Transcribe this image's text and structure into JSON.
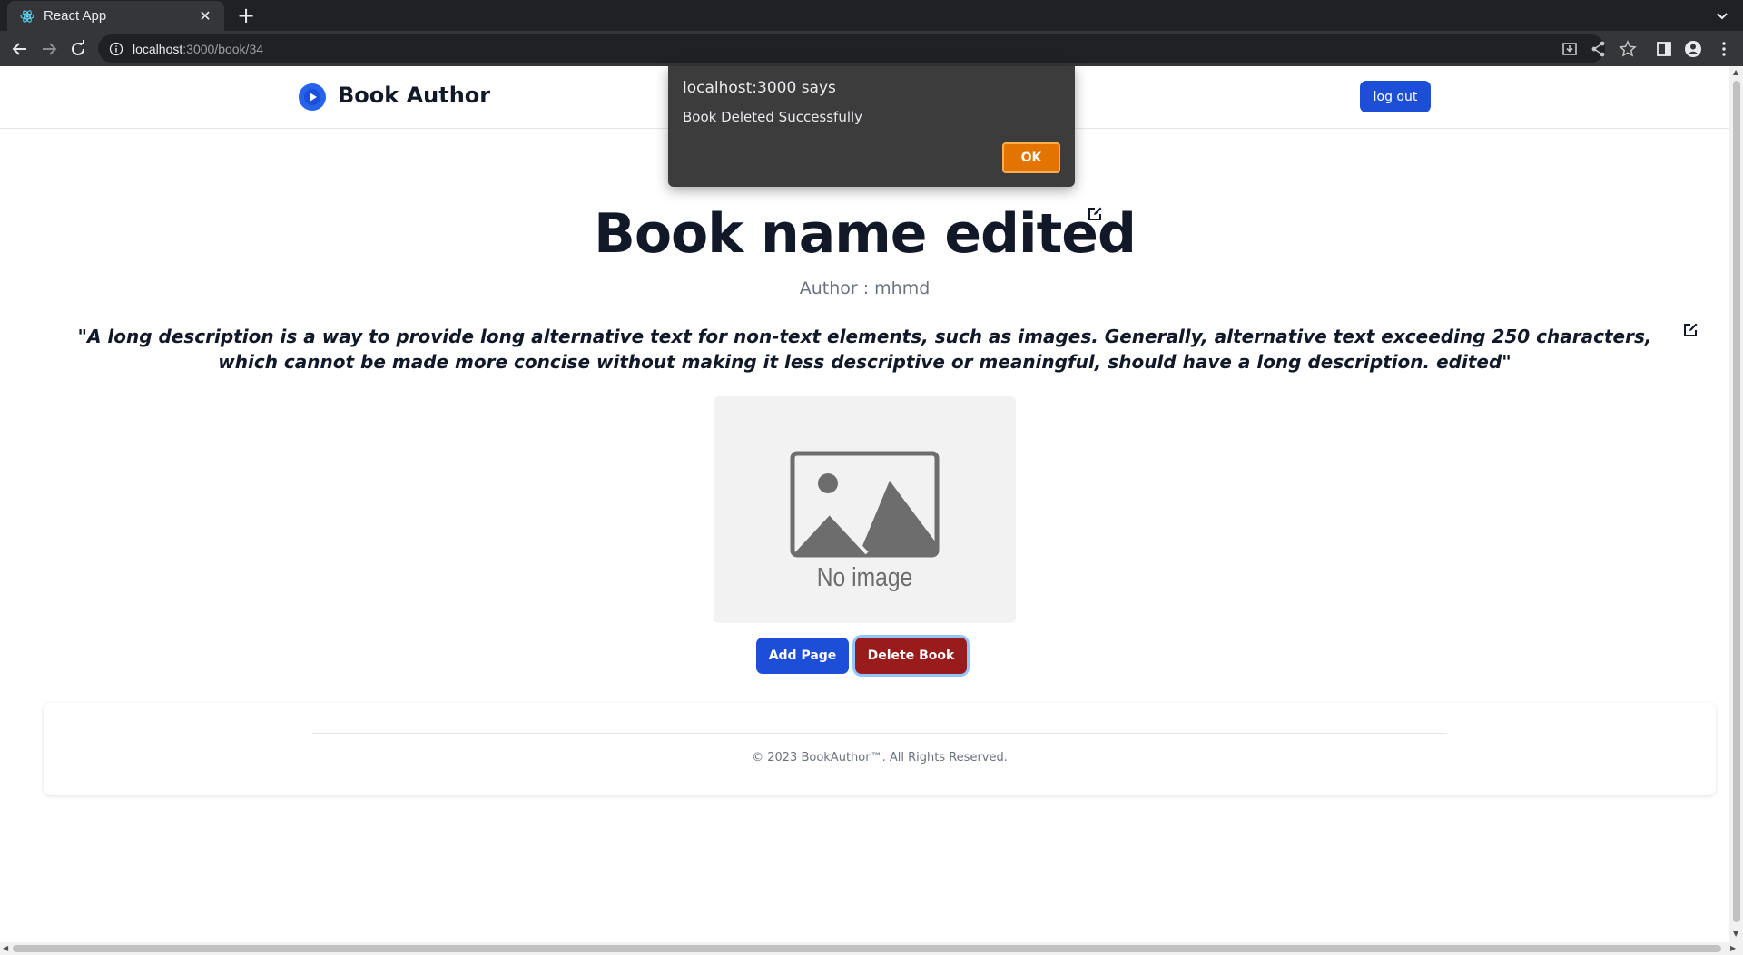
{
  "browser": {
    "tab_title": "React App",
    "url_host": "localhost",
    "url_path": ":3000/book/34"
  },
  "navbar": {
    "brand": "Book Author",
    "logout_label": "log out"
  },
  "book": {
    "title": "Book name edited",
    "author": "Author : mhmd",
    "description": "\"A long description is a way to provide long alternative text for non-text elements, such as images. Generally, alternative text exceeding 250 characters, which cannot be made more concise without making it less descriptive or meaningful, should have a long description. edited\"",
    "image_placeholder": "No image"
  },
  "actions": {
    "add_page": "Add Page",
    "delete_book": "Delete Book"
  },
  "footer": {
    "copyright": "© 2023 BookAuthor™. All Rights Reserved."
  },
  "dialog": {
    "origin": "localhost:3000 says",
    "message": "Book Deleted Successfully",
    "ok_label": "OK"
  },
  "colors": {
    "primary_button": "#1d4ed8",
    "danger_button": "#991b1b",
    "dialog_ok": "#e37400"
  },
  "icons": [
    "react-favicon",
    "close-icon",
    "plus-icon",
    "back-icon",
    "forward-icon",
    "reload-icon",
    "info-icon",
    "install-icon",
    "share-icon",
    "star-icon",
    "side-panel-icon",
    "profile-icon",
    "menu-icon",
    "play-logo-icon",
    "edit-icon",
    "no-image-icon"
  ]
}
